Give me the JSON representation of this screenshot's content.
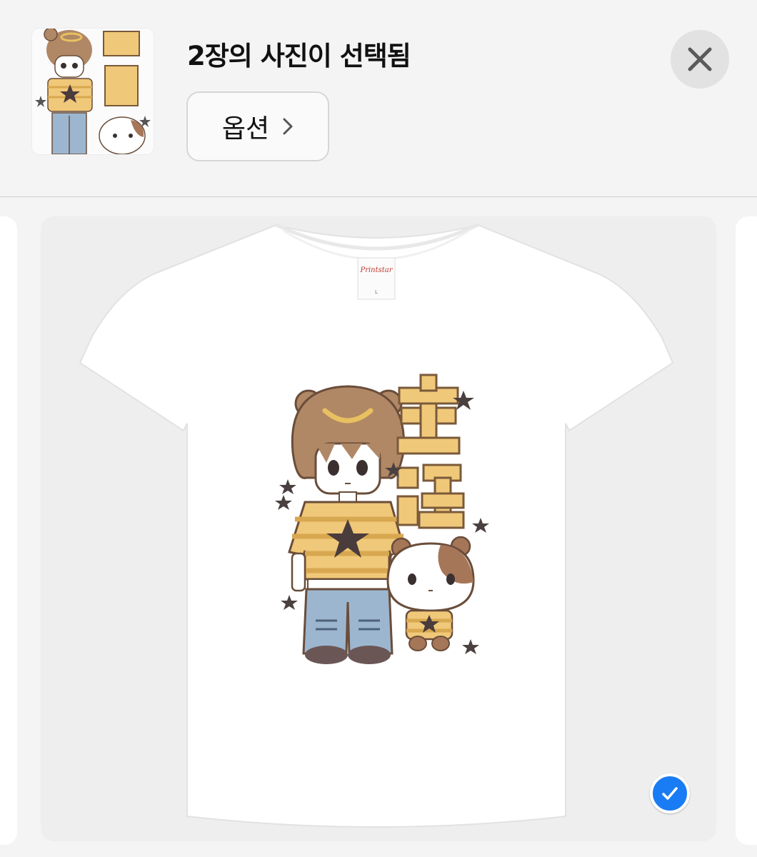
{
  "header": {
    "title": "2장의 사진이 선택됨",
    "options_label": "옵션"
  },
  "shirt": {
    "tag_brand": "Printstar",
    "tag_size": "L"
  },
  "icons": {
    "close": "close-icon",
    "chevron": "chevron-right-icon",
    "check": "checkmark-icon"
  },
  "colors": {
    "accent": "#1a7cf5",
    "shirt_stripe": "#f0c879",
    "hair": "#b08866",
    "jeans": "#9db6cf"
  }
}
